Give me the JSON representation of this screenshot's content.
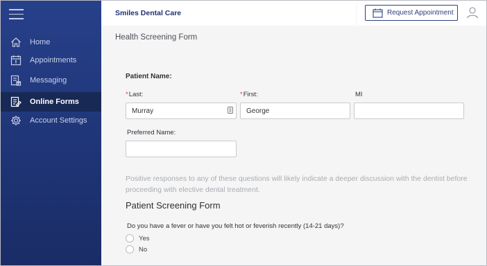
{
  "app": {
    "brand": "Smiles Dental Care",
    "request_button": "Request Appointment"
  },
  "sidebar": {
    "items": [
      {
        "label": "Home",
        "icon": "home-icon",
        "active": false
      },
      {
        "label": "Appointments",
        "icon": "calendar-icon",
        "active": false
      },
      {
        "label": "Messaging",
        "icon": "message-icon",
        "active": false
      },
      {
        "label": "Online Forms",
        "icon": "forms-icon",
        "active": true
      },
      {
        "label": "Account Settings",
        "icon": "gear-icon",
        "active": false
      }
    ]
  },
  "form": {
    "page_title": "Health Screening Form",
    "patient_name_label": "Patient Name:",
    "last_label": "Last:",
    "first_label": "First:",
    "mi_label": "MI",
    "last_value": "Murray",
    "first_value": "George",
    "mi_value": "",
    "preferred_label": "Preferred Name:",
    "preferred_value": "",
    "note": "Positive responses to any of these questions will likely indicate a deeper discussion with the dentist before proceeding with elective dental treatment.",
    "section_title": "Patient Screening Form",
    "question": "Do you have a fever or have you felt hot or feverish recently (14-21 days)?",
    "options": [
      "Yes",
      "No"
    ]
  },
  "colors": {
    "sidebar": "#23397d",
    "sidebar_active": "#182955",
    "accent": "#2c3f7d",
    "required": "#d64545"
  }
}
